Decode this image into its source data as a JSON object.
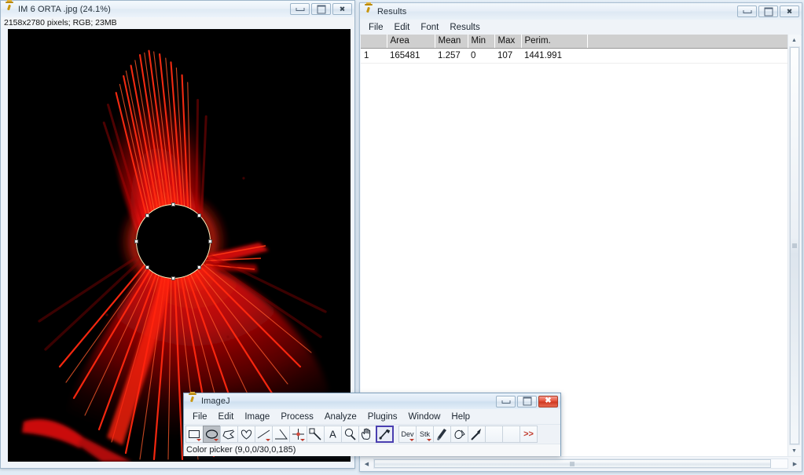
{
  "desktop": {
    "background": "#dce8f2"
  },
  "image_window": {
    "title": "IM 6 ORTA .jpg (24.1%)",
    "icon": "microscope-icon",
    "info_line": "2158x2780 pixels; RGB; 23MB",
    "zoom_percent": "24.1%",
    "dimensions": "2158x2780",
    "color_mode": "RGB",
    "file_size": "23MB",
    "buttons": {
      "minimize": "minimize",
      "maximize": "maximize",
      "close": "close"
    },
    "selection": {
      "type": "oval",
      "handles": 8
    }
  },
  "results_window": {
    "title": "Results",
    "icon": "microscope-icon",
    "buttons": {
      "minimize": "minimize",
      "maximize": "maximize",
      "close": "close"
    },
    "menus": [
      "File",
      "Edit",
      "Font",
      "Results"
    ],
    "columns": [
      "",
      "Area",
      "Mean",
      "Min",
      "Max",
      "Perim.",
      ""
    ],
    "rows": [
      {
        "index": "1",
        "area": "165481",
        "mean": "1.257",
        "min": "0",
        "max": "107",
        "perim": "1441.991"
      }
    ],
    "scrollbar_up": "▲",
    "scrollbar_down": "▼",
    "scrollbar_left": "◀",
    "scrollbar_right": "▶"
  },
  "imagej_window": {
    "title": "ImageJ",
    "icon": "microscope-icon",
    "buttons": {
      "minimize": "minimize",
      "maximize": "maximize",
      "close": "close"
    },
    "menus": [
      "File",
      "Edit",
      "Image",
      "Process",
      "Analyze",
      "Plugins",
      "Window",
      "Help"
    ],
    "tools": [
      {
        "name": "rectangle-tool",
        "label": "",
        "selected": false,
        "dropdown": true
      },
      {
        "name": "oval-tool",
        "label": "",
        "selected": true,
        "dropdown": true
      },
      {
        "name": "polygon-tool",
        "label": "",
        "selected": false,
        "dropdown": false
      },
      {
        "name": "freehand-tool",
        "label": "",
        "selected": false,
        "dropdown": false
      },
      {
        "name": "line-tool",
        "label": "",
        "selected": false,
        "dropdown": true
      },
      {
        "name": "angle-tool",
        "label": "",
        "selected": false,
        "dropdown": false
      },
      {
        "name": "point-tool",
        "label": "",
        "selected": false,
        "dropdown": true
      },
      {
        "name": "wand-tool",
        "label": "",
        "selected": false,
        "dropdown": false
      },
      {
        "name": "text-tool",
        "label": "A",
        "selected": false,
        "dropdown": false
      },
      {
        "name": "magnifier-tool",
        "label": "",
        "selected": false,
        "dropdown": false
      },
      {
        "name": "hand-tool",
        "label": "",
        "selected": false,
        "dropdown": false
      },
      {
        "name": "color-picker-tool",
        "label": "",
        "selected": false,
        "dropdown": false
      },
      {
        "name": "dev-tool",
        "label": "Dev",
        "selected": false,
        "dropdown": true
      },
      {
        "name": "stack-tool",
        "label": "Stk",
        "selected": false,
        "dropdown": true
      },
      {
        "name": "brush-tool",
        "label": "",
        "selected": false,
        "dropdown": false
      },
      {
        "name": "flood-fill-tool",
        "label": "",
        "selected": false,
        "dropdown": false
      },
      {
        "name": "arrow-tool",
        "label": "",
        "selected": false,
        "dropdown": false
      },
      {
        "name": "empty-slot-1",
        "label": "",
        "selected": false,
        "dropdown": false
      },
      {
        "name": "empty-slot-2",
        "label": "",
        "selected": false,
        "dropdown": false
      },
      {
        "name": "more-tools",
        "label": ">>",
        "selected": false,
        "dropdown": false
      }
    ],
    "status_text": "Color picker (9,0,0/30,0,185)",
    "picker_values": "9,0,0/30,0,185"
  },
  "colors": {
    "corona_red": "#ee0c0c",
    "corona_dark_red": "#8c0505",
    "canvas_black": "#000000",
    "roi_outline": "#ffeebb",
    "close_button_red": "#e4523b",
    "selected_tool_border": "#4a3fb0"
  }
}
